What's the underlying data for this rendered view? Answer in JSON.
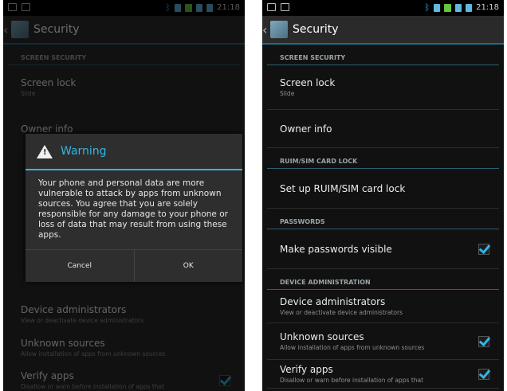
{
  "status_bar": {
    "time": "21:18"
  },
  "action_bar": {
    "title": "Security"
  },
  "sections": {
    "screen_security": "SCREEN SECURITY",
    "ruim_sim": "RUIM/SIM CARD LOCK",
    "passwords": "PASSWORDS",
    "device_admin": "DEVICE ADMINISTRATION"
  },
  "items": {
    "screen_lock": {
      "title": "Screen lock",
      "summary": "Slide"
    },
    "owner_info": {
      "title": "Owner info"
    },
    "sim_lock": {
      "title": "Set up RUIM/SIM card lock"
    },
    "passwords_visible": {
      "title": "Make passwords visible",
      "checked": true
    },
    "device_admins": {
      "title": "Device administrators",
      "summary": "View or deactivate device administrators"
    },
    "unknown_sources": {
      "title": "Unknown sources",
      "summary": "Allow installation of apps from unknown sources",
      "checked": true
    },
    "verify_apps": {
      "title": "Verify apps",
      "summary": "Disallow or warn before installation of apps that",
      "checked": true
    }
  },
  "dialog": {
    "title": "Warning",
    "message": "Your phone and personal data are more vulnerable to attack by apps from unknown sources. You agree that you are solely responsible for any damage to your phone or loss of data that may result from using these apps.",
    "cancel": "Cancel",
    "ok": "OK"
  },
  "colors": {
    "accent": "#33b5e5",
    "background": "#111111"
  }
}
